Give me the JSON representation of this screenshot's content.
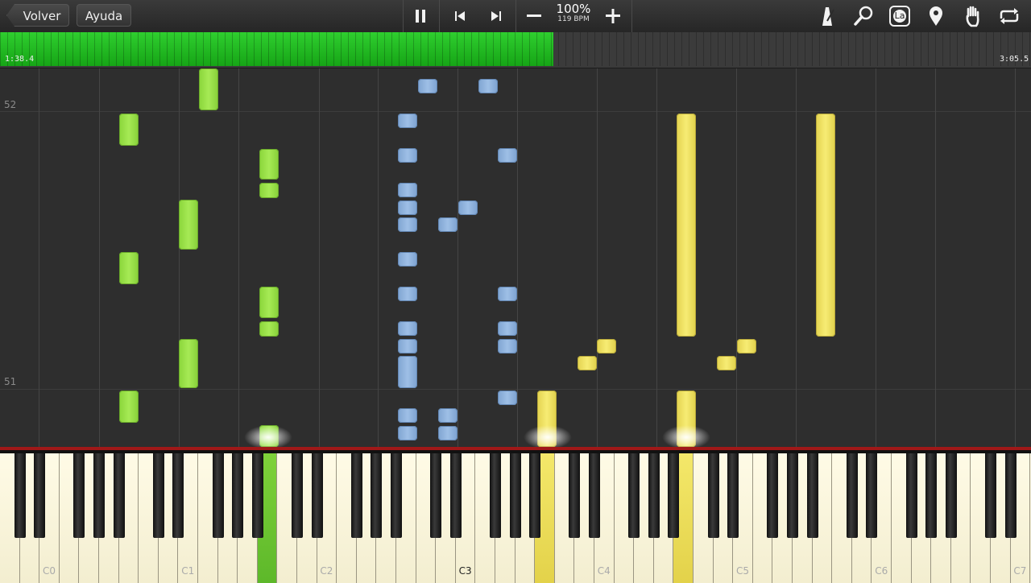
{
  "toolbar": {
    "back_label": "Volver",
    "help_label": "Ayuda",
    "zoom_percent": "100%",
    "tempo": "119 BPM",
    "icons": [
      "pause-icon",
      "skip-back-icon",
      "skip-forward-icon",
      "minus-icon",
      "plus-icon",
      "metronome-icon",
      "search-icon",
      "key-label-icon",
      "location-pin-icon",
      "hand-icon",
      "loop-icon"
    ],
    "key_label_glyph": "La"
  },
  "progress": {
    "current_time": "1:38.4",
    "total_time": "3:05.5",
    "fraction": 0.537
  },
  "measures": [
    "52",
    "51"
  ],
  "octave_labels": [
    "C0",
    "C1",
    "C2",
    "C3",
    "C4",
    "C5",
    "C6",
    "C7"
  ],
  "highlighted_octave_label": "C3",
  "colors": {
    "left_hand": "#98dd46",
    "right_hand_blue": "#8fb3dd",
    "right_hand_yellow": "#f0e466",
    "progress": "#22bb22",
    "keyboard_border": "#a01818"
  }
}
